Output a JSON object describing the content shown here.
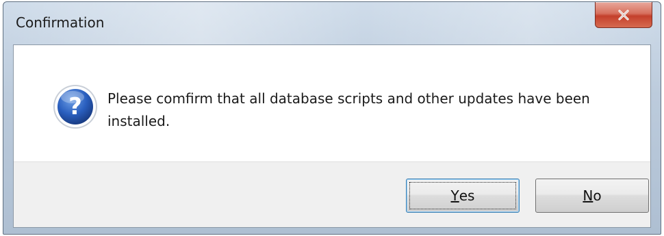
{
  "window": {
    "title": "Confirmation",
    "close_icon": "close-icon"
  },
  "message": {
    "icon": "question-icon",
    "text": "Please comfirm that all database scripts and other updates have been installed."
  },
  "buttons": {
    "yes": {
      "mnemonic": "Y",
      "rest": "es",
      "is_default": true
    },
    "no": {
      "mnemonic": "N",
      "rest": "o",
      "is_default": false
    }
  },
  "colors": {
    "close_button": "#c4402c",
    "question_icon": "#1f4fa8",
    "default_button_border": "#3c7fb1"
  }
}
